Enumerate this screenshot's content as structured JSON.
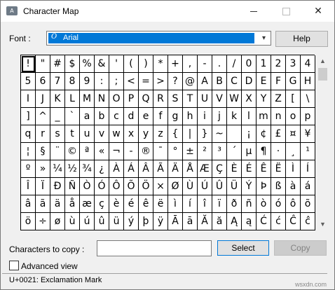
{
  "window": {
    "title": "Character Map",
    "controls": {
      "minimize": "—",
      "maximize": "☐",
      "close": "✕"
    }
  },
  "font": {
    "label": "Font :",
    "value": "Arial",
    "icon_glyph": "O",
    "dropdown_glyph": "▾"
  },
  "help_label": "Help",
  "grid": {
    "rows": [
      [
        "!",
        "\"",
        "#",
        "$",
        "%",
        "&",
        "'",
        "(",
        ")",
        "*",
        "+",
        ",",
        "-",
        ".",
        "/",
        "0",
        "1",
        "2",
        "3",
        "4"
      ],
      [
        "5",
        "6",
        "7",
        "8",
        "9",
        ":",
        ";",
        "<",
        "=",
        ">",
        "?",
        "@",
        "A",
        "B",
        "C",
        "D",
        "E",
        "F",
        "G",
        "H"
      ],
      [
        "I",
        "J",
        "K",
        "L",
        "M",
        "N",
        "O",
        "P",
        "Q",
        "R",
        "S",
        "T",
        "U",
        "V",
        "W",
        "X",
        "Y",
        "Z",
        "[",
        "\\"
      ],
      [
        "]",
        "^",
        "_",
        "`",
        "a",
        "b",
        "c",
        "d",
        "e",
        "f",
        "g",
        "h",
        "i",
        "j",
        "k",
        "l",
        "m",
        "n",
        "o",
        "p"
      ],
      [
        "q",
        "r",
        "s",
        "t",
        "u",
        "v",
        "w",
        "x",
        "y",
        "z",
        "{",
        "|",
        "}",
        "~",
        " ",
        "¡",
        "¢",
        "£",
        "¤",
        "¥"
      ],
      [
        "¦",
        "§",
        "¨",
        "©",
        "ª",
        "«",
        "¬",
        "-",
        "®",
        "¯",
        "°",
        "±",
        "²",
        "³",
        "´",
        "µ",
        "¶",
        "·",
        "¸",
        "¹"
      ],
      [
        "º",
        "»",
        "¼",
        "½",
        "¾",
        "¿",
        "À",
        "Á",
        "Â",
        "Ã",
        "Ä",
        "Å",
        "Æ",
        "Ç",
        "È",
        "É",
        "Ê",
        "Ë",
        "Ì",
        "Í"
      ],
      [
        "Î",
        "Ï",
        "Ð",
        "Ñ",
        "Ò",
        "Ó",
        "Ô",
        "Õ",
        "Ö",
        "×",
        "Ø",
        "Ù",
        "Ú",
        "Û",
        "Ü",
        "Ý",
        "Þ",
        "ß",
        "à",
        "á"
      ],
      [
        "â",
        "ã",
        "ä",
        "å",
        "æ",
        "ç",
        "è",
        "é",
        "ê",
        "ë",
        "ì",
        "í",
        "î",
        "ï",
        "ð",
        "ñ",
        "ò",
        "ó",
        "ô",
        "õ"
      ],
      [
        "ö",
        "÷",
        "ø",
        "ù",
        "ú",
        "û",
        "ü",
        "ý",
        "þ",
        "ÿ",
        "Ā",
        "ā",
        "Ă",
        "ă",
        "Ą",
        "ą",
        "Ć",
        "ć",
        "Ĉ",
        "ĉ"
      ]
    ],
    "selected": "!"
  },
  "scrollbar": {
    "up_glyph": "▲",
    "down_glyph": "▼"
  },
  "copy": {
    "label": "Characters to copy :",
    "value": "",
    "select_label": "Select",
    "copy_label": "Copy"
  },
  "advanced_view": {
    "label": "Advanced view",
    "checked": false
  },
  "status": "U+0021: Exclamation Mark",
  "watermark": "wsxdn.com"
}
